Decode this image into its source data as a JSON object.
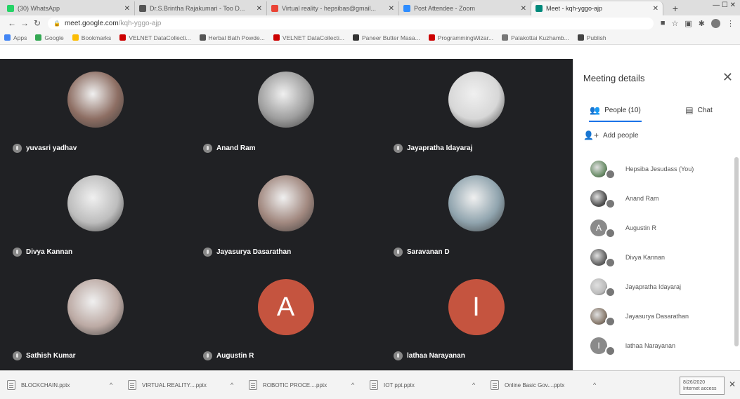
{
  "browser": {
    "tabs": [
      {
        "title": "(30) WhatsApp",
        "close": "✕"
      },
      {
        "title": "Dr.S.Brintha Rajakumari - Too D...",
        "close": "✕"
      },
      {
        "title": "Virtual reality - hepsibas@gmail...",
        "close": "✕"
      },
      {
        "title": "Post Attendee - Zoom",
        "close": "✕"
      },
      {
        "title": "Meet - kqh-yggo-ajp",
        "close": "✕"
      }
    ],
    "new_tab": "+",
    "address": {
      "host": "meet.google.com",
      "path": "/kqh-yggo-ajp"
    },
    "bookmarks": [
      {
        "label": "Apps",
        "color": "#4285f4"
      },
      {
        "label": "Google",
        "color": "#34a853"
      },
      {
        "label": "Bookmarks",
        "color": "#fbbc05"
      },
      {
        "label": "VELNET DataCollecti...",
        "color": "#cc0000"
      },
      {
        "label": "Herbal Bath Powde...",
        "color": "#555555"
      },
      {
        "label": "VELNET DataCollecti...",
        "color": "#cc0000"
      },
      {
        "label": "Paneer Butter Masa...",
        "color": "#333333"
      },
      {
        "label": "ProgrammingWizar...",
        "color": "#cc0000"
      },
      {
        "label": "Palakottai Kuzhamb...",
        "color": "#777777"
      },
      {
        "label": "Publish",
        "color": "#444444"
      }
    ]
  },
  "meet": {
    "tiles": [
      {
        "name": "yuvasri yadhav",
        "avatar": "photo",
        "color": "#8d6e63"
      },
      {
        "name": "Anand Ram",
        "avatar": "photo",
        "color": "#9e9e9e"
      },
      {
        "name": "Jayapratha Idayaraj",
        "avatar": "photo",
        "color": "#d7d7d7"
      },
      {
        "name": "Divya Kannan",
        "avatar": "photo",
        "color": "#bdbdbd"
      },
      {
        "name": "Jayasurya Dasarathan",
        "avatar": "photo",
        "color": "#a1887f"
      },
      {
        "name": "Saravanan D",
        "avatar": "photo",
        "color": "#90a4ae"
      },
      {
        "name": "Sathish Kumar",
        "avatar": "photo",
        "color": "#bcaaa4"
      },
      {
        "name": "Augustin R",
        "avatar": "letter",
        "letter": "A",
        "color": "#c5543f"
      },
      {
        "name": "lathaa Narayanan",
        "avatar": "letter",
        "letter": "I",
        "color": "#c5543f"
      }
    ]
  },
  "panel": {
    "title": "Meeting details",
    "close": "✕",
    "tabs": [
      {
        "label": "People (10)",
        "icon": "people-icon"
      },
      {
        "label": "Chat",
        "icon": "chat-icon"
      }
    ],
    "add_people": "Add people",
    "people": [
      {
        "name": "Hepsiba Jesudass (You)",
        "avatar": "photo",
        "color": "#6d8f6a"
      },
      {
        "name": "Anand Ram",
        "avatar": "photo",
        "color": "#555555"
      },
      {
        "name": "Augustin R",
        "avatar": "letter",
        "letter": "A",
        "color": "#8a8a8a"
      },
      {
        "name": "Divya Kannan",
        "avatar": "photo",
        "color": "#666666"
      },
      {
        "name": "Jayapratha Idayaraj",
        "avatar": "photo",
        "color": "#bbbbbb"
      },
      {
        "name": "Jayasurya Dasarathan",
        "avatar": "photo",
        "color": "#8b7d70"
      },
      {
        "name": "lathaa Narayanan",
        "avatar": "letter",
        "letter": "I",
        "color": "#8a8a8a"
      }
    ]
  },
  "downloads": {
    "items": [
      {
        "name": "BLOCKCHAIN.pptx"
      },
      {
        "name": "VIRTUAL REALITY....pptx"
      },
      {
        "name": "ROBOTIC PROCE....pptx"
      },
      {
        "name": "IOT ppt.pptx"
      },
      {
        "name": "Online Basic Gov....pptx"
      }
    ],
    "time_label": "8/26/2020",
    "time_sub": "Internet access",
    "close": "✕"
  }
}
